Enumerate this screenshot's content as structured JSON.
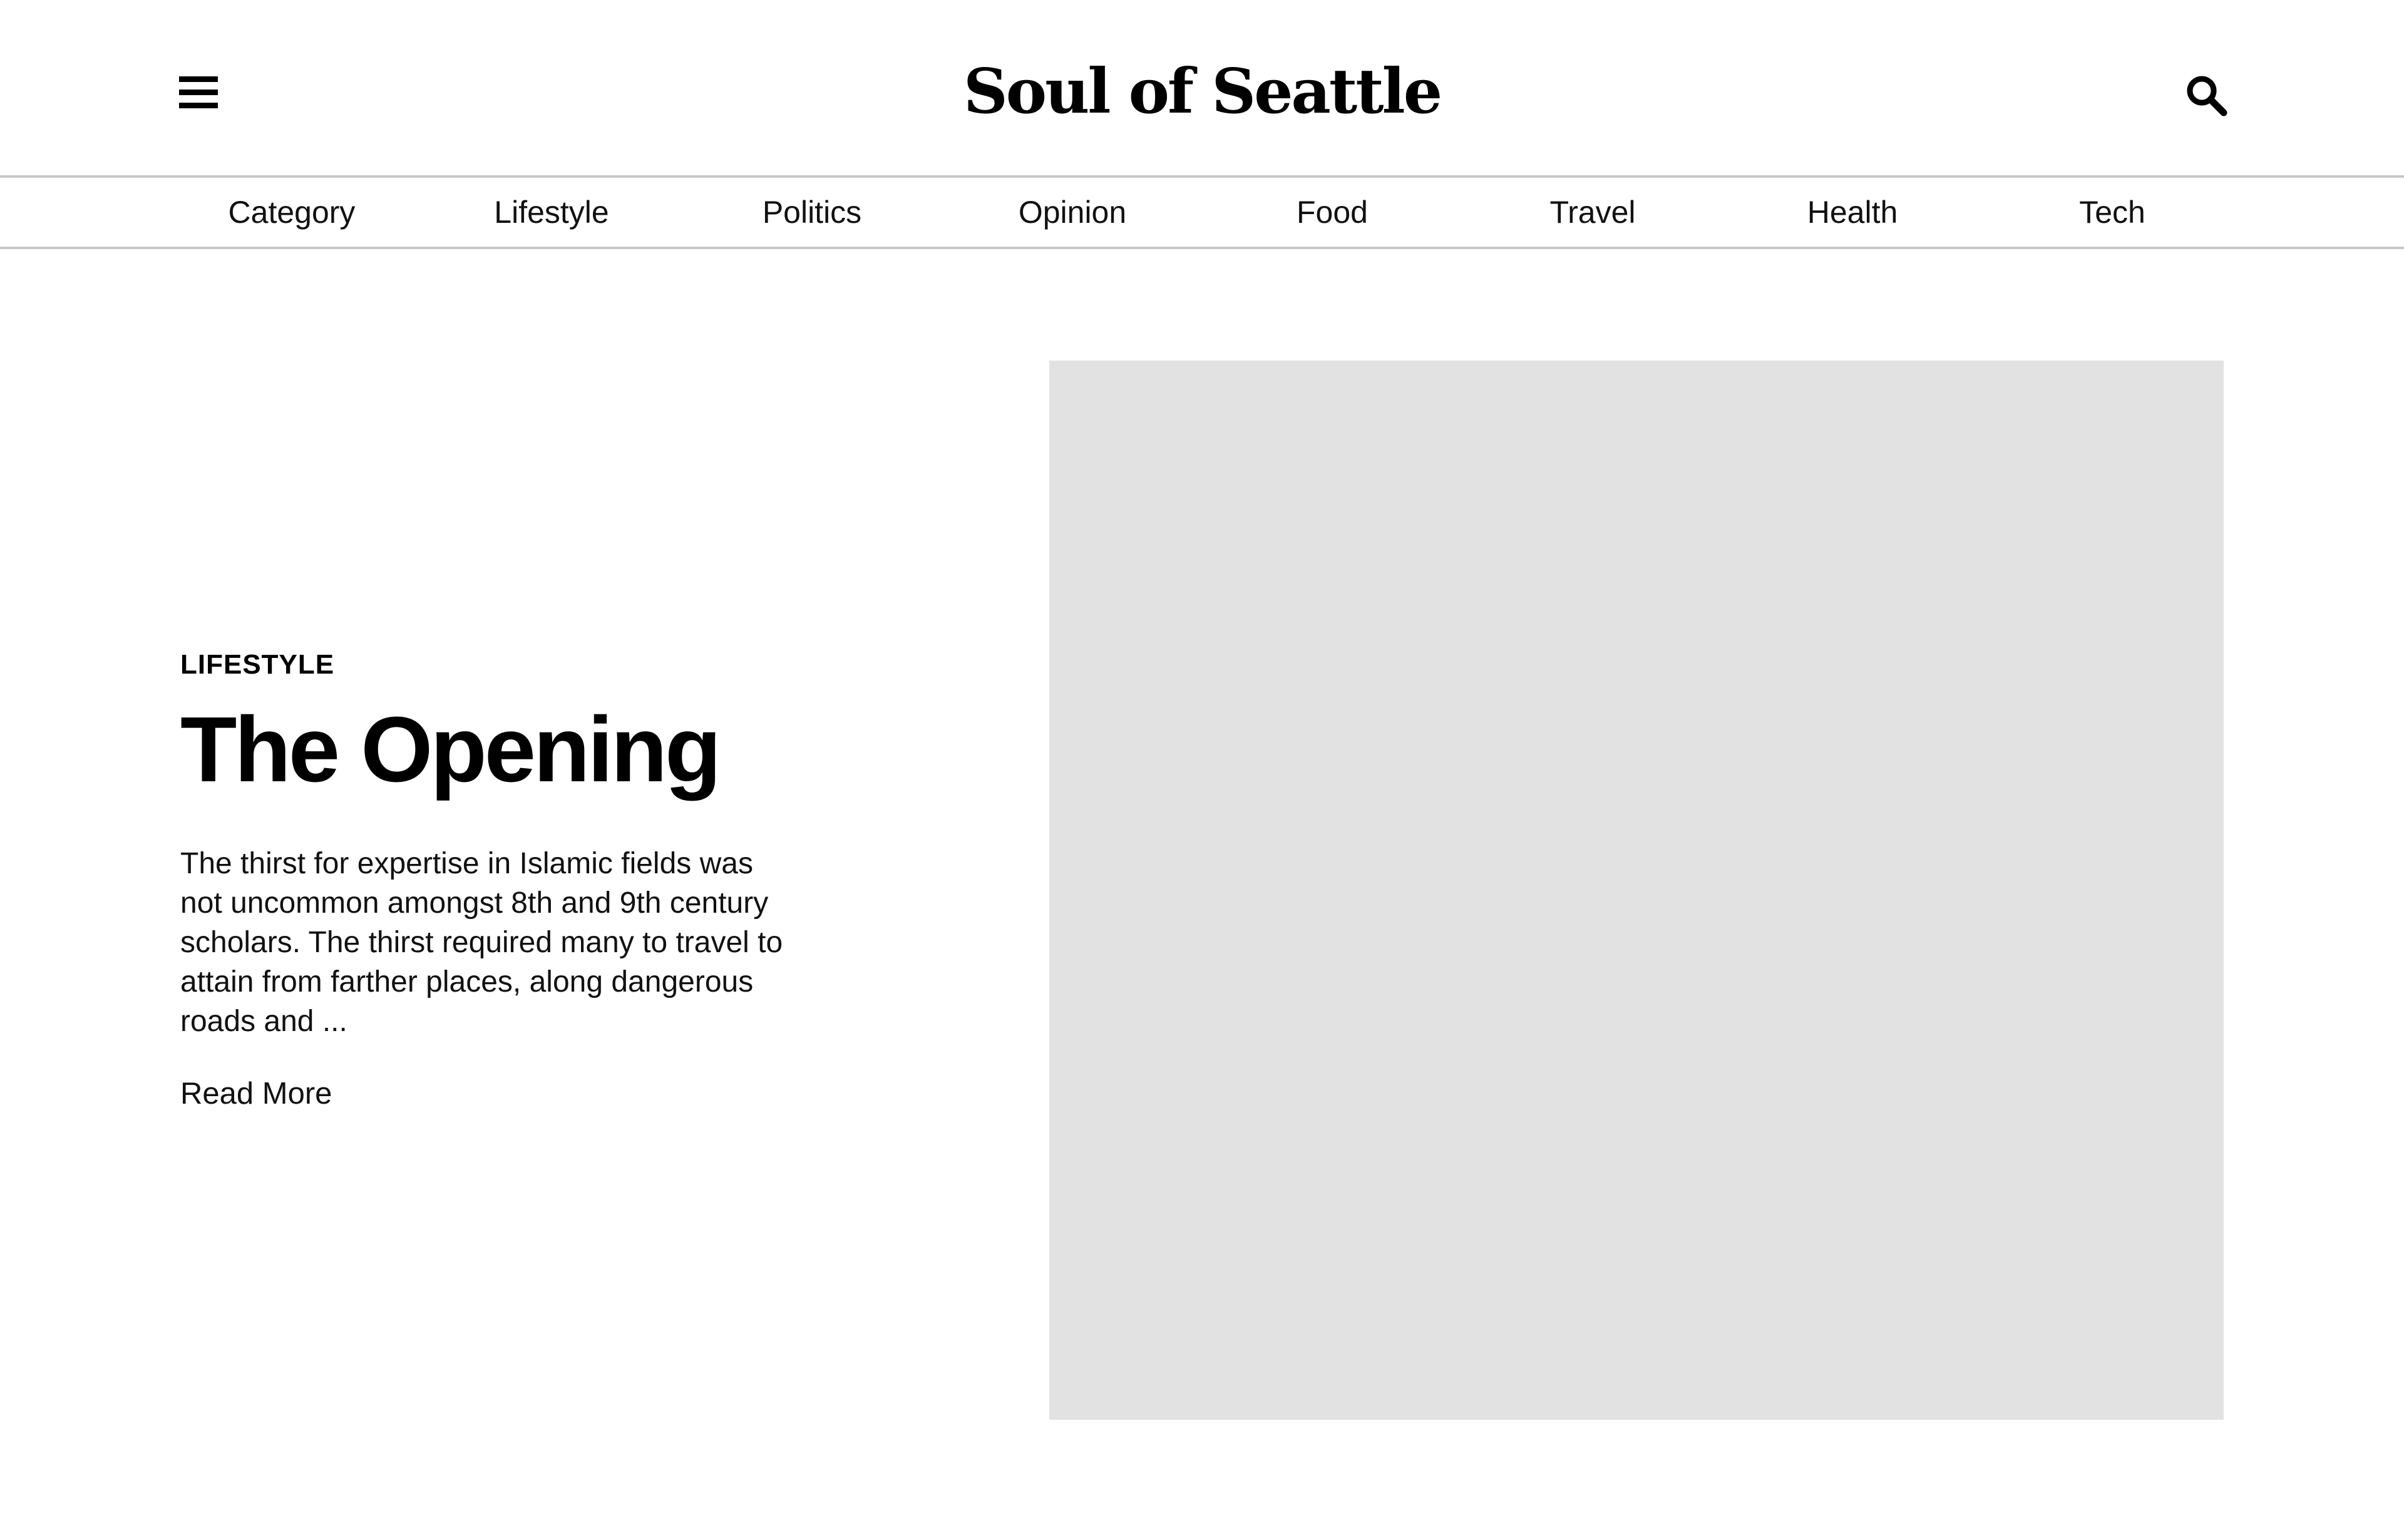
{
  "header": {
    "brand": "Soul of Seattle",
    "menu_icon": "hamburger-menu-icon",
    "search_icon": "search-icon"
  },
  "nav": {
    "items": [
      {
        "label": "Category"
      },
      {
        "label": "Lifestyle"
      },
      {
        "label": "Politics"
      },
      {
        "label": "Opinion"
      },
      {
        "label": "Food"
      },
      {
        "label": "Travel"
      },
      {
        "label": "Health"
      },
      {
        "label": "Tech"
      }
    ]
  },
  "hero": {
    "category": "LIFESTYLE",
    "title": "The Opening",
    "excerpt": "The thirst for expertise in Islamic fields was not uncommon amongst 8th and 9th century scholars. The thirst required many to travel to attain from farther places, along dangerous roads and ...",
    "read_more": "Read More",
    "image_placeholder_color": "#e2e2e2"
  }
}
